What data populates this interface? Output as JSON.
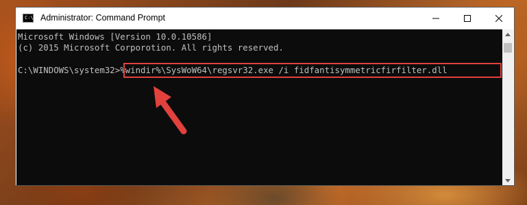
{
  "window": {
    "title": "Administrator: Command Prompt",
    "app_icon_text": "C:\\"
  },
  "console": {
    "lines": [
      "Microsoft Windows [Version 10.0.10586]",
      "(c) 2015 Microsoft Corporotion. All rights reserved."
    ],
    "prompt": "C:\\WINDOWS\\system32>",
    "command": "%windir%\\SysWoW64\\regsvr32.exe /i fidfantisymmetricfirfilter.dll"
  },
  "annotation": {
    "highlight_color": "#e2413c",
    "arrow_color": "#e2413c"
  }
}
